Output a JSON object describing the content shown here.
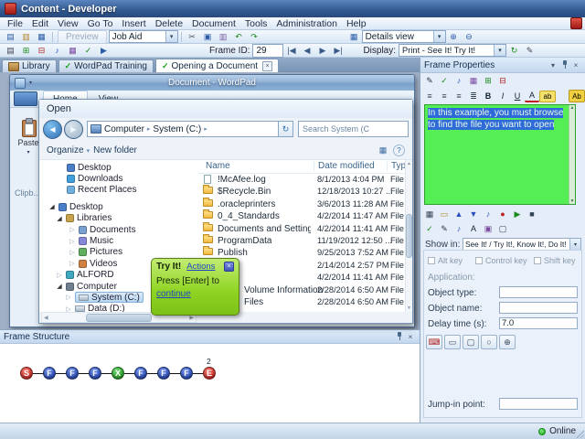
{
  "titlebar": {
    "title": "Content - Developer"
  },
  "menubar": {
    "items": [
      "File",
      "Edit",
      "View",
      "Go To",
      "Insert",
      "Delete",
      "Document",
      "Tools",
      "Administration",
      "Help"
    ]
  },
  "toolbar_top": {
    "preview_label": "Preview",
    "template_value": "Job Aid",
    "view_value": "Details view"
  },
  "toolbar_frame": {
    "frame_id_label": "Frame ID:",
    "frame_id_value": "29",
    "display_label": "Display:",
    "display_value": "Print - See It! Try It!"
  },
  "doc_tabs": {
    "library": "Library",
    "training": "WordPad Training",
    "opening": "Opening a Document"
  },
  "wordpad": {
    "title": "Document - WordPad",
    "tab_home": "Home",
    "tab_view": "View",
    "paste_label": "Paste",
    "clipboard_group": "Clipb..."
  },
  "open_dialog": {
    "title": "Open",
    "breadcrumb_computer": "Computer",
    "breadcrumb_drive": "System (C:)",
    "search_value": "Search System (C",
    "organize_label": "Organize",
    "new_folder_label": "New folder",
    "col_name": "Name",
    "col_date": "Date modified",
    "col_type": "Typ",
    "tree": [
      {
        "label": "Desktop"
      },
      {
        "label": "Downloads"
      },
      {
        "label": "Recent Places"
      },
      {
        "label": "Desktop"
      },
      {
        "label": "Libraries"
      },
      {
        "label": "Documents"
      },
      {
        "label": "Music"
      },
      {
        "label": "Pictures"
      },
      {
        "label": "Videos"
      },
      {
        "label": "ALFORD"
      },
      {
        "label": "Computer"
      },
      {
        "label": "System (C:)"
      },
      {
        "label": "Data (D:)"
      }
    ],
    "files": [
      {
        "name": "!McAfee.log",
        "date": "8/1/2013 4:04 PM",
        "type": "File"
      },
      {
        "name": "$Recycle.Bin",
        "date": "12/18/2013 10:27 ...",
        "type": "File f"
      },
      {
        "name": ".oracleprinters",
        "date": "3/6/2013 11:28 AM",
        "type": "File f"
      },
      {
        "name": "0_4_Standards",
        "date": "4/2/2014 11:47 AM",
        "type": "File f"
      },
      {
        "name": "Documents and Settings",
        "date": "4/2/2014 11:41 AM",
        "type": "File f"
      },
      {
        "name": "ProgramData",
        "date": "11/19/2012 12:50 ...",
        "type": "File f"
      },
      {
        "name": "Publish",
        "date": "9/25/2013 7:52 AM",
        "type": "File f"
      },
      {
        "name": "",
        "date": "2/14/2014 2:57 PM",
        "type": "File f"
      },
      {
        "name": "",
        "date": "4/2/2014 11:41 AM",
        "type": "File f"
      },
      {
        "name": "Volume Information",
        "date": "2/28/2014 6:50 AM",
        "type": "File f"
      },
      {
        "name": "Files",
        "date": "2/28/2014 6:50 AM",
        "type": "File f"
      }
    ]
  },
  "tryit": {
    "title": "Try It!",
    "actions": "Actions",
    "line1": "Press [Enter] to",
    "link": "continue"
  },
  "frame_properties": {
    "title": "Frame Properties",
    "bubble_text": "In this example, you must browse to find the file you want to open",
    "bubble_bg": "#55ef55",
    "selection_bg": "#2f6bd8",
    "show_in_label": "Show in:",
    "show_in_value": "See It! / Try It!, Know It!, Do It!",
    "alt_key": "Alt key",
    "control_key": "Control key",
    "shift_key": "Shift key",
    "application_label": "Application:",
    "object_type_label": "Object type:",
    "object_type_value": "",
    "object_name_label": "Object name:",
    "object_name_value": "",
    "delay_label": "Delay time (s):",
    "delay_value": "7.0",
    "jump_label": "Jump-in point:",
    "jump_value": ""
  },
  "frame_structure": {
    "title": "Frame Structure",
    "annotation": "2",
    "nodes": [
      {
        "label": "S",
        "color": "#d03030"
      },
      {
        "label": "F",
        "color": "#2a50c0"
      },
      {
        "label": "F",
        "color": "#2a50c0"
      },
      {
        "label": "F",
        "color": "#2a50c0"
      },
      {
        "label": "X",
        "color": "#28a828"
      },
      {
        "label": "F",
        "color": "#2a50c0"
      },
      {
        "label": "F",
        "color": "#2a50c0"
      },
      {
        "label": "F",
        "color": "#2a50c0"
      },
      {
        "label": "E",
        "color": "#d03030"
      }
    ]
  },
  "statusbar": {
    "online": "Online"
  },
  "icons": {
    "new_document": "▤",
    "open": "▥",
    "save": "▦",
    "cut": "✂",
    "copy": "▣",
    "paste": "▥",
    "undo": "↶",
    "redo": "↷",
    "monitor": "▦",
    "zoom_in": "⊕",
    "zoom_out": "⊖",
    "properties": "▤",
    "insert_frame": "⊞",
    "delete_frame": "⊟",
    "sound": "♪",
    "image": "▦",
    "spellcheck": "✓",
    "play": "▶",
    "nav_first": "|◀",
    "nav_prev": "◀",
    "nav_next": "▶",
    "nav_last": "▶|",
    "refresh": "↻",
    "edit": "✎",
    "dropdown": "▾",
    "breadcrumb_arrow": "▸",
    "back": "◀",
    "forward": "▶",
    "close": "×",
    "check": "✓",
    "help": "?",
    "views": "▦",
    "expander_open": "◢",
    "expander_closed": "▷",
    "align_left": "≡",
    "align_center": "≡",
    "align_right": "≡",
    "bullets": "≣",
    "bold": "B",
    "italic": "I",
    "underline": "U",
    "font_color": "A",
    "highlight": "ab",
    "translate": "Ab",
    "capture": "▦",
    "folder_small": "▭",
    "arrow_up": "▲",
    "arrow_down": "▼",
    "record": "●",
    "stop": "■",
    "keyboard": "⌨",
    "drag": "▭",
    "region": "▢",
    "point": "○",
    "zoom": "⊕"
  }
}
